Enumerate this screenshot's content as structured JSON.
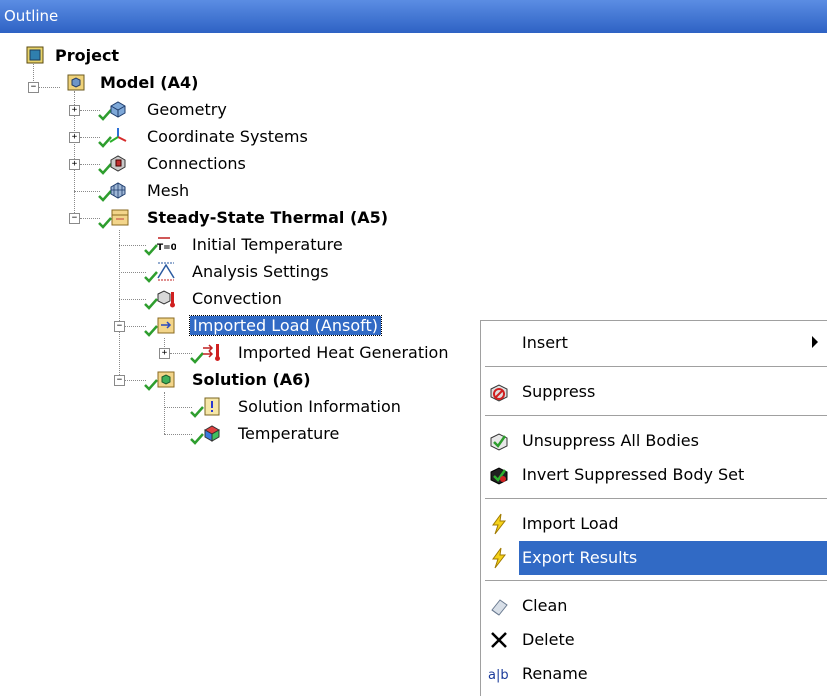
{
  "title": "Outline",
  "tree": {
    "project": "Project",
    "model": "Model (A4)",
    "geometry": "Geometry",
    "coordinate_systems": "Coordinate Systems",
    "connections": "Connections",
    "mesh": "Mesh",
    "steady_state": "Steady-State Thermal (A5)",
    "initial_temperature": "Initial Temperature",
    "initial_temperature_icon_text": "T=0",
    "analysis_settings": "Analysis Settings",
    "convection": "Convection",
    "imported_load": "Imported Load (Ansoft)",
    "imported_heat": "Imported Heat Generation",
    "solution": "Solution (A6)",
    "solution_information": "Solution Information",
    "temperature": "Temperature",
    "expand_symbol": "+",
    "collapse_symbol": "−"
  },
  "context_menu": {
    "insert": "Insert",
    "suppress": "Suppress",
    "unsuppress_all": "Unsuppress All Bodies",
    "invert_suppressed": "Invert Suppressed Body Set",
    "import_load": "Import Load",
    "export_results": "Export Results",
    "clean": "Clean",
    "delete": "Delete",
    "rename": "Rename",
    "rename_icon_text": "a|b"
  },
  "colors": {
    "title_bar": "#2e62c4",
    "selection": "#316ac5",
    "check": "#2e9e2e"
  }
}
